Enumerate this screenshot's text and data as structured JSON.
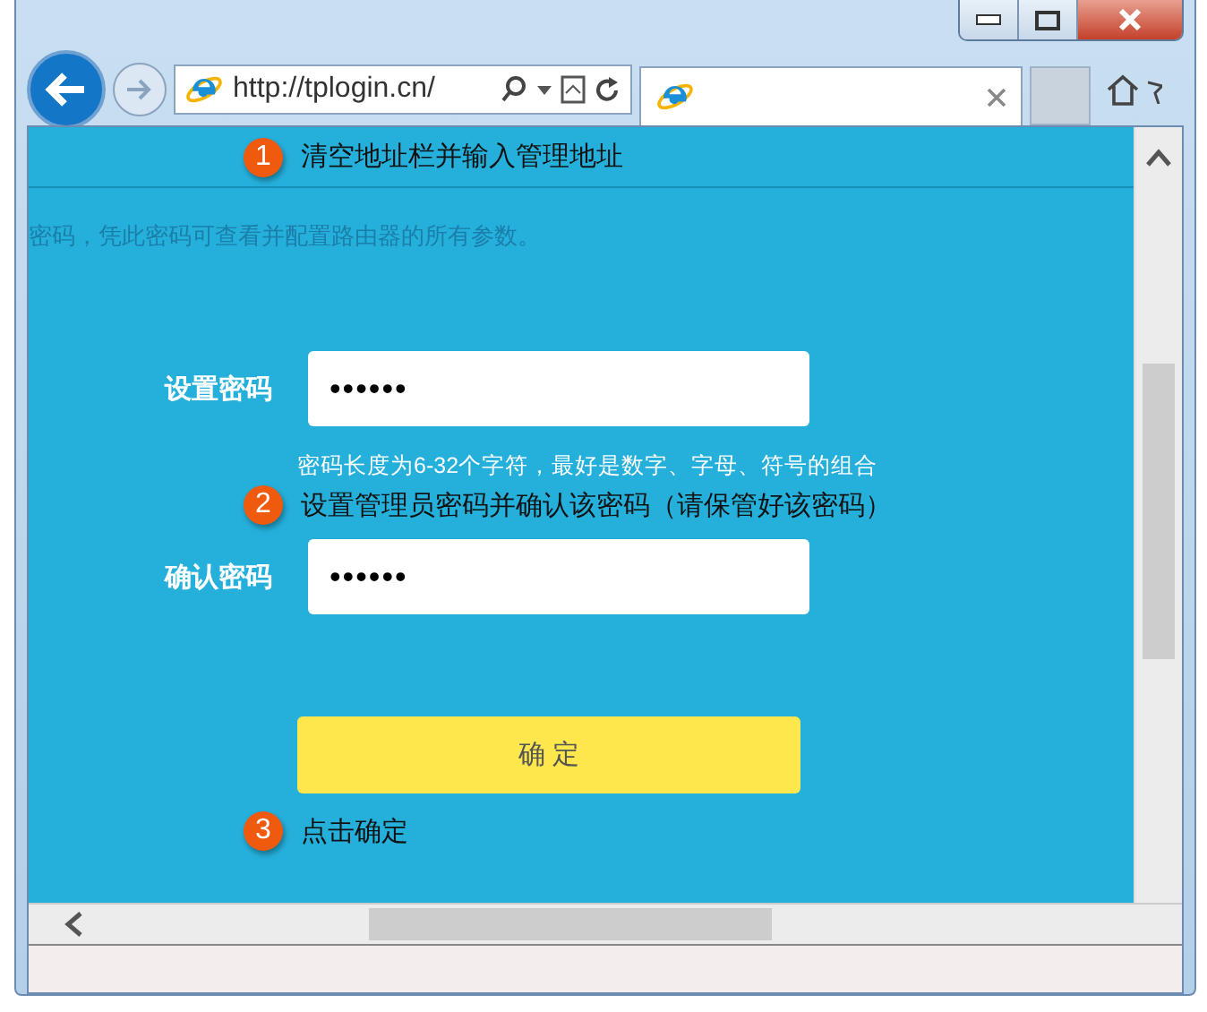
{
  "address_bar": {
    "url": "http://tplogin.cn/"
  },
  "page": {
    "intro": "密码，凭此密码可查看并配置路由器的所有参数。",
    "fields": [
      {
        "label": "设置密码",
        "value": "••••••"
      },
      {
        "label": "确认密码",
        "value": "••••••"
      }
    ],
    "hint": "密码长度为6-32个字符，最好是数字、字母、符号的组合",
    "button": "确 定"
  },
  "annotations": [
    {
      "number": "1",
      "text": "清空地址栏并输入管理地址"
    },
    {
      "number": "2",
      "text": "设置管理员密码并确认该密码（请保管好该密码）"
    },
    {
      "number": "3",
      "text": "点击确定"
    }
  ]
}
